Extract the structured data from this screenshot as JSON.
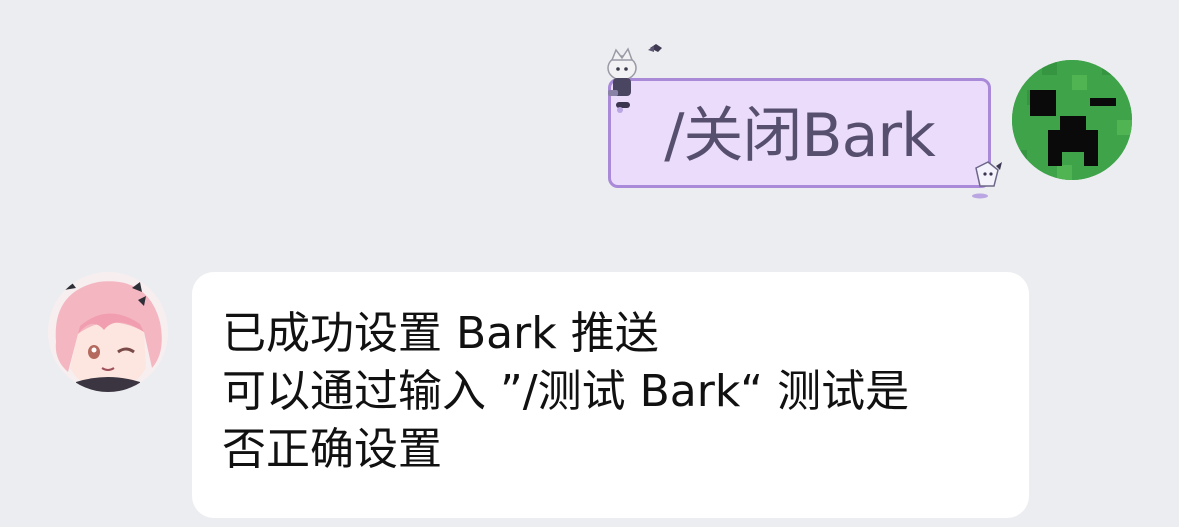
{
  "messages": {
    "outgoing": {
      "text": "/关闭Bark",
      "avatar_icon": "creeper-face-icon",
      "bubble_color": "#ecdcfb",
      "border_color": "#a98ad8"
    },
    "incoming": {
      "avatar_icon": "anime-pink-hair-avatar-icon",
      "lines": [
        "已成功设置 Bark 推送",
        "可以通过输入 ”/测试 Bark“ 测试是",
        "否正确设置"
      ]
    }
  },
  "colors": {
    "background": "#ecedf1",
    "incoming_bubble": "#ffffff",
    "creeper_green": "#3fa34a"
  }
}
